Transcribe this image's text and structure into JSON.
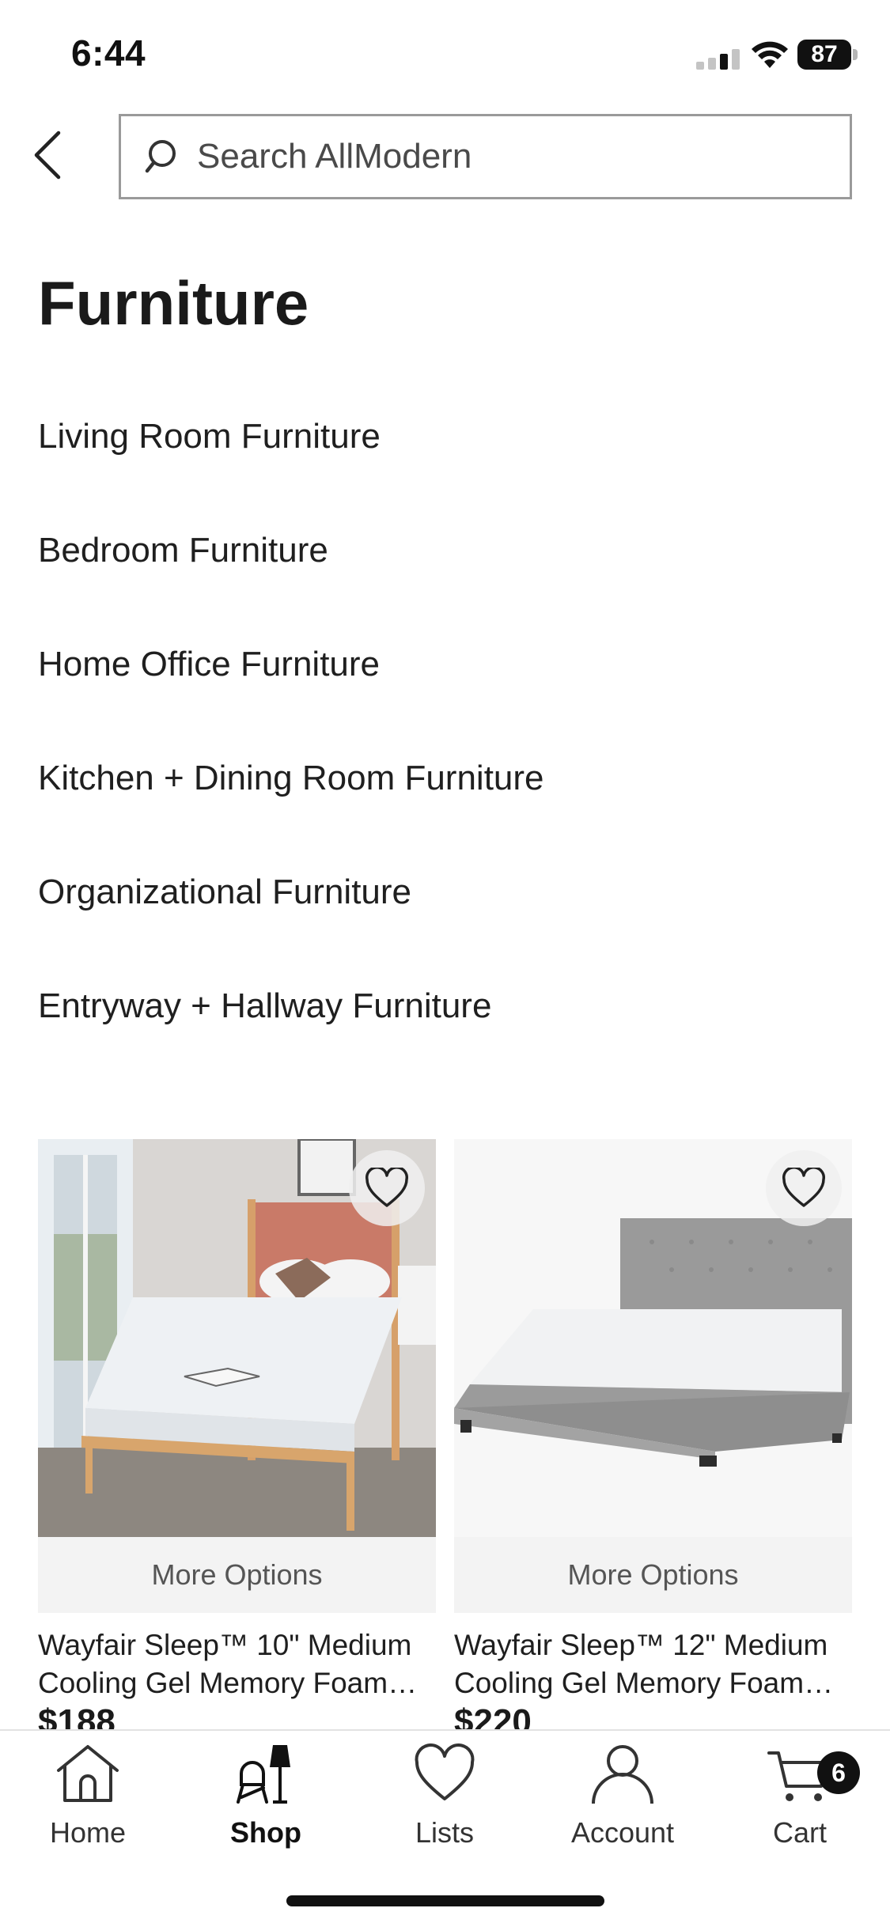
{
  "status_bar": {
    "time": "6:44",
    "battery": "87"
  },
  "search": {
    "placeholder": "Search AllModern"
  },
  "page_title": "Furniture",
  "categories": [
    {
      "label": "Living Room Furniture"
    },
    {
      "label": "Bedroom Furniture"
    },
    {
      "label": "Home Office Furniture"
    },
    {
      "label": "Kitchen + Dining Room Furniture"
    },
    {
      "label": "Organizational Furniture"
    },
    {
      "label": "Entryway + Hallway Furniture"
    }
  ],
  "products": [
    {
      "more_options": "More Options",
      "name": "Wayfair Sleep™ 10\" Medium Cooling Gel Memory Foam…",
      "price": "$188"
    },
    {
      "more_options": "More Options",
      "name": "Wayfair Sleep™ 12\" Medium Cooling Gel Memory Foam…",
      "price": "$220"
    }
  ],
  "tab_bar": {
    "tabs": [
      {
        "label": "Home",
        "icon": "home-icon"
      },
      {
        "label": "Shop",
        "icon": "shop-icon",
        "active": true
      },
      {
        "label": "Lists",
        "icon": "heart-icon"
      },
      {
        "label": "Account",
        "icon": "account-icon"
      },
      {
        "label": "Cart",
        "icon": "cart-icon"
      }
    ],
    "cart_count": "6"
  },
  "colors": {
    "text": "#1f1f1f",
    "border": "#9a9a9a",
    "panel": "#f3f3f3",
    "badge": "#111111"
  }
}
